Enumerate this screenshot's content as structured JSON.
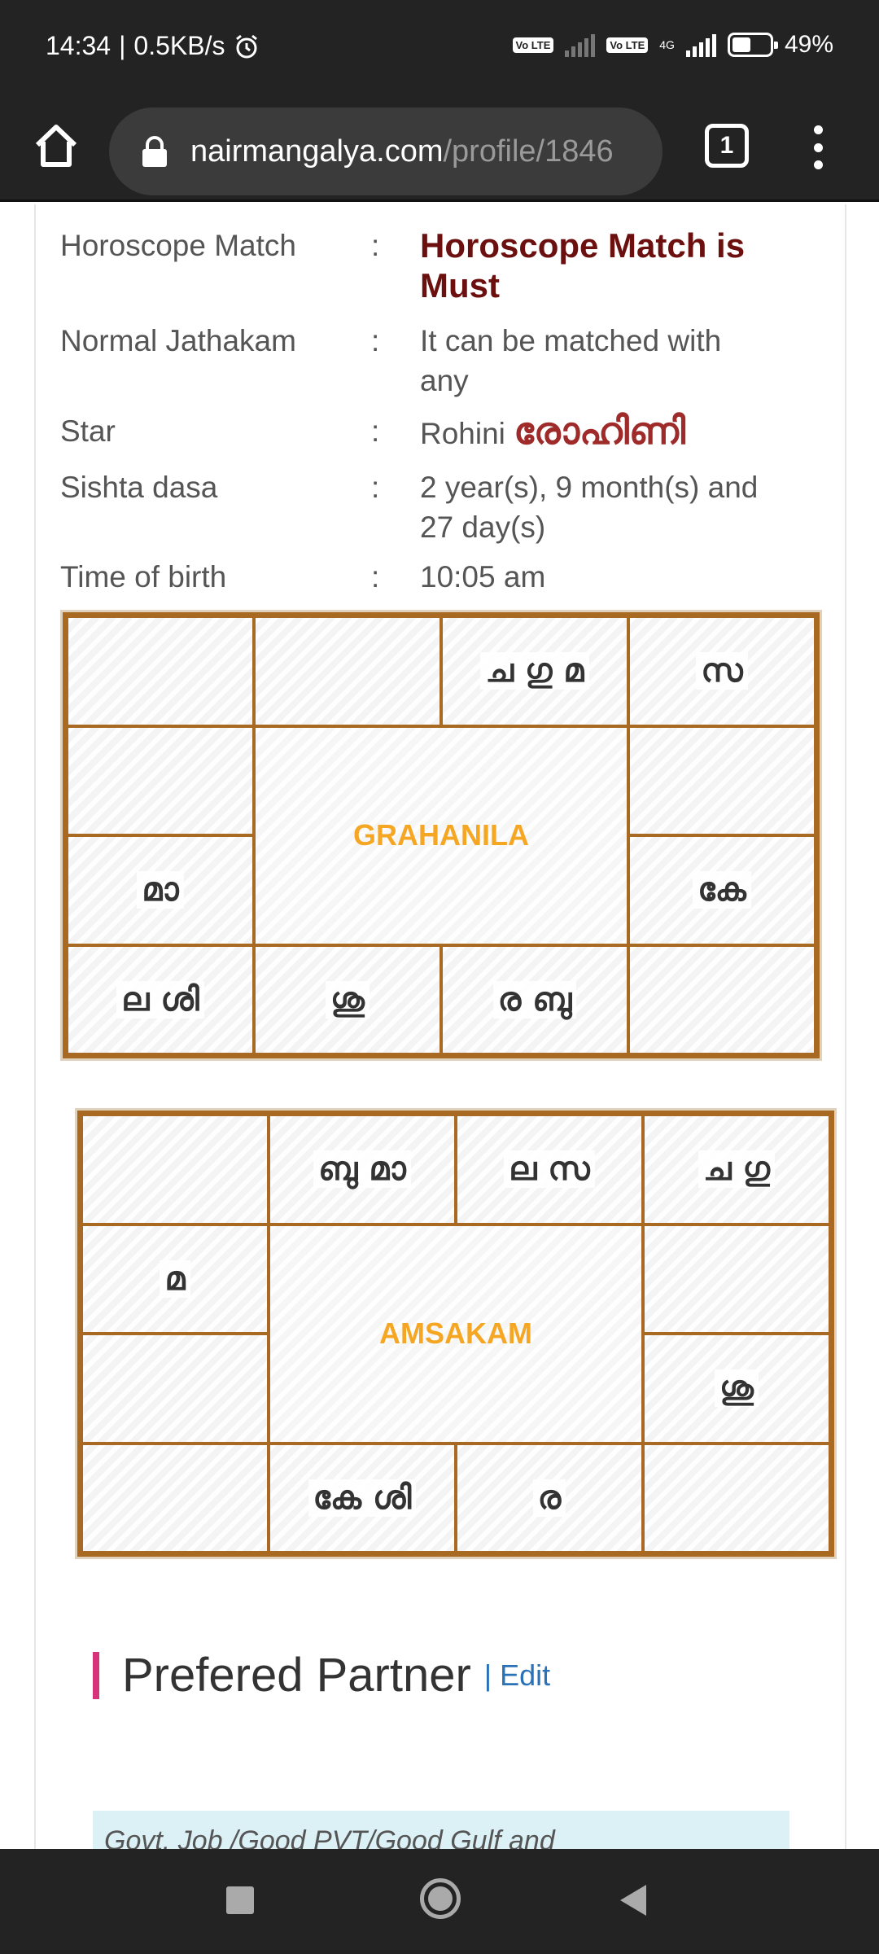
{
  "status_bar": {
    "time": "14:34",
    "separator": "|",
    "net_speed": "0.5KB/s",
    "sim1_label": "Vo LTE",
    "sim2_label": "Vo LTE",
    "network_type": "4G",
    "battery_percent": "49%",
    "battery_level": 0.49
  },
  "browser": {
    "url_domain": "nairmangalya.com",
    "url_path": "/profile/1846",
    "tab_count": "1"
  },
  "details": {
    "rows": [
      {
        "label": "Horoscope Match",
        "colon": ":",
        "value": "Horoscope Match is Must"
      },
      {
        "label": "Normal Jathakam",
        "colon": ":",
        "value": "It can be matched with any"
      },
      {
        "label": "Star",
        "colon": ":",
        "value": "Rohini",
        "value_mal": "രോഹിണി"
      },
      {
        "label": "Sishta dasa",
        "colon": ":",
        "value": "2 year(s), 9 month(s) and 27 day(s)"
      },
      {
        "label": "Time of birth",
        "colon": ":",
        "value": "10:05 am"
      }
    ]
  },
  "grahanila": {
    "title": "GRAHANILA",
    "cells": {
      "r1c1": "",
      "r1c2": "",
      "r1c3": "ച ഗു മ",
      "r1c4": "സ",
      "r2c1": "",
      "r2c4": "",
      "r3c1": "മാ",
      "r3c4": "കേ",
      "r4c1": "ല ശി",
      "r4c2": "ശു",
      "r4c3": "ര ബു",
      "r4c4": ""
    }
  },
  "amsakam": {
    "title": "AMSAKAM",
    "cells": {
      "r1c1": "",
      "r1c2": "ബു മാ",
      "r1c3": "ല സ",
      "r1c4": "ച ഗു",
      "r2c1": "മ",
      "r2c4": "",
      "r3c1": "",
      "r3c4": "ശു",
      "r4c1": "",
      "r4c2": "കേ ശി",
      "r4c3": "ര",
      "r4c4": ""
    }
  },
  "preferred_partner": {
    "title": "Prefered Partner",
    "edit_label": "| Edit",
    "box_text": "Govt. Job /Good PVT/Good Gulf and"
  },
  "icons": {
    "home": "home-icon",
    "lock": "lock-icon",
    "tabs": "tabs-icon",
    "menu": "more-vert-icon",
    "alarm": "alarm-icon"
  }
}
